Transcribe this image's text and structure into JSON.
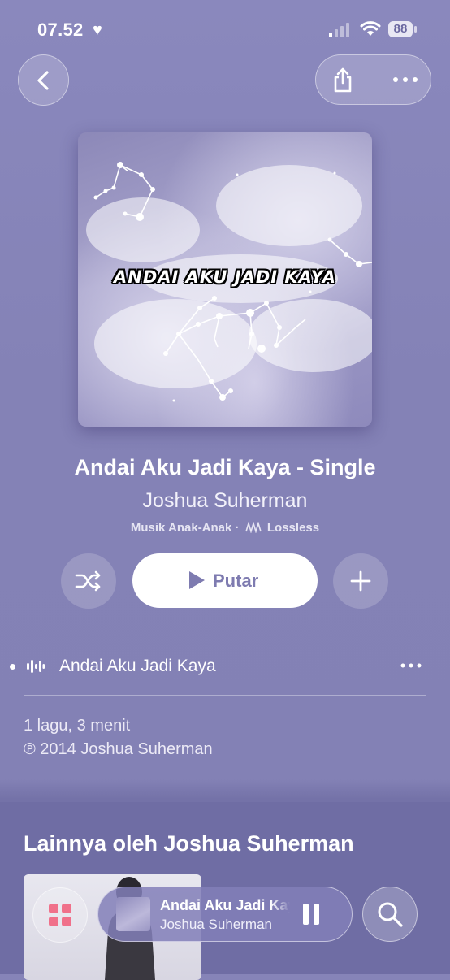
{
  "status_bar": {
    "time": "07.52",
    "battery": "88"
  },
  "album": {
    "artwork_text": "ANDAI AKU JADI KAYA",
    "title": "Andai Aku Jadi Kaya - Single",
    "artist": "Joshua Suherman",
    "genre": "Musik Anak-Anak",
    "separator": "·",
    "quality": "Lossless"
  },
  "controls": {
    "play_label": "Putar"
  },
  "tracks": [
    {
      "title": "Andai Aku Jadi Kaya"
    }
  ],
  "summary": {
    "count_duration": "1 lagu, 3 menit",
    "copyright": "℗ 2014 Joshua Suherman"
  },
  "more_section": {
    "header": "Lainnya oleh Joshua Suherman"
  },
  "mini_player": {
    "title": "Andai Aku Jadi Kaya",
    "artist": "Joshua Suherman"
  },
  "colors": {
    "background": "#8684b8",
    "play_text": "#7e7bb0",
    "grid_icon": "#f0708a"
  }
}
